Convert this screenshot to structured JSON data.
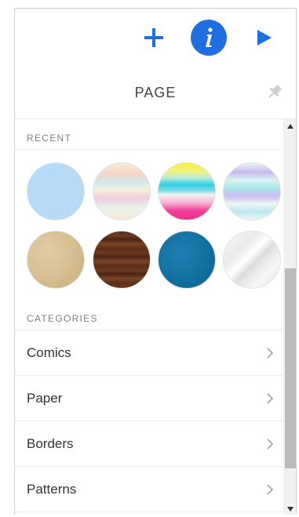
{
  "toolbar": {
    "add_icon": "plus-icon",
    "info_icon": "info-icon",
    "play_icon": "play-icon",
    "accent_color": "#1f6fe0"
  },
  "header": {
    "title": "PAGE",
    "pin_icon": "pin-icon"
  },
  "recent": {
    "label": "RECENT",
    "swatches": [
      {
        "name": "light-blue"
      },
      {
        "name": "pastel-rainbow-watercolor"
      },
      {
        "name": "yellow-cyan-pink-stripes"
      },
      {
        "name": "lavender-aqua-watercolor"
      },
      {
        "name": "beige-paper-texture"
      },
      {
        "name": "dark-wood"
      },
      {
        "name": "teal-blue-texture"
      },
      {
        "name": "white-marble"
      }
    ]
  },
  "categories": {
    "label": "CATEGORIES",
    "items": [
      {
        "label": "Comics"
      },
      {
        "label": "Paper"
      },
      {
        "label": "Borders"
      },
      {
        "label": "Patterns"
      }
    ]
  }
}
